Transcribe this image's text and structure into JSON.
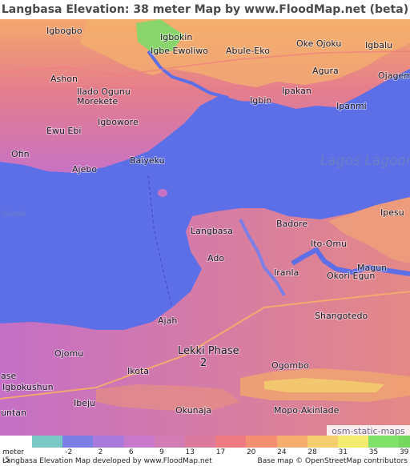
{
  "title": "Langbasa Elevation: 38 meter Map by www.FloodMap.net (beta)",
  "places": [
    {
      "name": "Igbogbo"
    },
    {
      "name": "Igbokin"
    },
    {
      "name": "Igbe Ewoliwo"
    },
    {
      "name": "Abule-Eko"
    },
    {
      "name": "Oke Ojoku"
    },
    {
      "name": "Igbalu"
    },
    {
      "name": "Agura"
    },
    {
      "name": "Ojagemo"
    },
    {
      "name": "Ashon"
    },
    {
      "name": "Ilado Ogunu"
    },
    {
      "name": "Morekete"
    },
    {
      "name": "Igbin"
    },
    {
      "name": "Ipakan"
    },
    {
      "name": "Ipanmi"
    },
    {
      "name": "Igbowore"
    },
    {
      "name": "Ewu Ebi"
    },
    {
      "name": "Ofin"
    },
    {
      "name": "Baiyeku"
    },
    {
      "name": "Ajebo"
    },
    {
      "name": "Ipesu"
    },
    {
      "name": "Langbasa"
    },
    {
      "name": "Badore"
    },
    {
      "name": "Ito-Omu"
    },
    {
      "name": "Ado"
    },
    {
      "name": "Magun"
    },
    {
      "name": "Iranla"
    },
    {
      "name": "Okori Egun"
    },
    {
      "name": "Shangotedo"
    },
    {
      "name": "Ajah"
    },
    {
      "name": "Lekki Phase"
    },
    {
      "name": "2"
    },
    {
      "name": "Ojomu"
    },
    {
      "name": "Ogombo"
    },
    {
      "name": "Igbokushun"
    },
    {
      "name": "Ikota"
    },
    {
      "name": "Ibeju"
    },
    {
      "name": "Okunaja"
    },
    {
      "name": "Mopo-Akinlade"
    },
    {
      "name": "untan"
    },
    {
      "name": "ase"
    }
  ],
  "water_labels": {
    "lagoon": "Lagos Lagoon",
    "island": "Island"
  },
  "attribution_overlay": "osm-static-maps",
  "legend": {
    "unit_label": "meter",
    "ticks": [
      "-5",
      "-2",
      "2",
      "6",
      "9",
      "13",
      "17",
      "20",
      "24",
      "28",
      "31",
      "35",
      "39"
    ],
    "colors": [
      "#79c8c4",
      "#7b7fe6",
      "#a97adc",
      "#c879c9",
      "#d27bb5",
      "#dc7a9e",
      "#ef7b82",
      "#f48f73",
      "#f6ad70",
      "#f6cd6e",
      "#f3ec71",
      "#7fe16a",
      "#74d85e"
    ]
  },
  "footer": {
    "left": "Langbasa Elevation Map developed by www.FloodMap.net",
    "right": "Base map © OpenStreetMap contributors"
  },
  "colors": {
    "water": "#5d6fe6",
    "lowland": "#b46bd6",
    "highland": "#f2a86f"
  }
}
